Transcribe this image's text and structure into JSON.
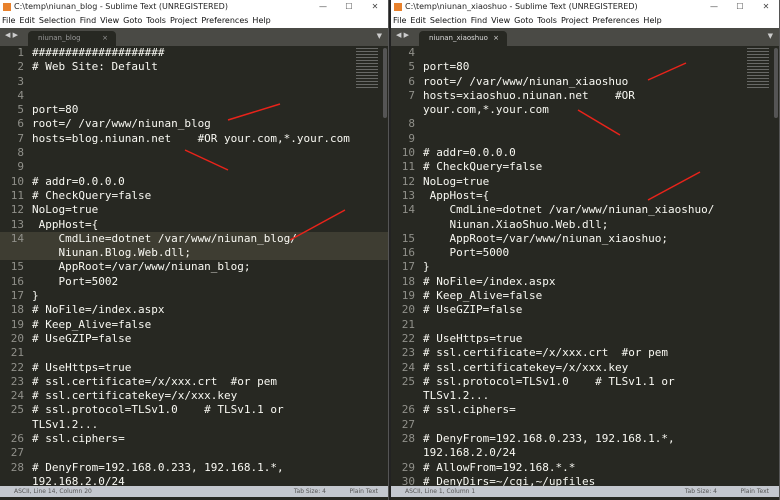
{
  "windows": [
    {
      "title": "C:\\temp\\niunan_blog - Sublime Text (UNREGISTERED)",
      "tab": "niunan_blog",
      "current_line": "14",
      "status": {
        "left": "ASCII, Line 14, Column 20",
        "tab_size": "Tab Size: 4",
        "syntax": "Plain Text"
      },
      "lines": [
        [
          "1",
          "####################"
        ],
        [
          "2",
          "# Web Site: Default"
        ],
        [
          "3",
          ""
        ],
        [
          "4",
          ""
        ],
        [
          "5",
          "port=80"
        ],
        [
          "6",
          "root=/ /var/www/niunan_blog"
        ],
        [
          "7",
          "hosts=blog.niunan.net    #OR your.com,*.your.com"
        ],
        [
          "8",
          ""
        ],
        [
          "9",
          ""
        ],
        [
          "10",
          "# addr=0.0.0.0"
        ],
        [
          "11",
          "# CheckQuery=false"
        ],
        [
          "12",
          "NoLog=true"
        ],
        [
          "13",
          " AppHost={"
        ],
        [
          "14",
          "    CmdLine=dotnet /var/www/niunan_blog/"
        ],
        [
          "",
          "    Niunan.Blog.Web.dll;"
        ],
        [
          "15",
          "    AppRoot=/var/www/niunan_blog;"
        ],
        [
          "16",
          "    Port=5002"
        ],
        [
          "17",
          "}"
        ],
        [
          "18",
          "# NoFile=/index.aspx"
        ],
        [
          "19",
          "# Keep_Alive=false"
        ],
        [
          "20",
          "# UseGZIP=false"
        ],
        [
          "21",
          ""
        ],
        [
          "22",
          "# UseHttps=true"
        ],
        [
          "23",
          "# ssl.certificate=/x/xxx.crt  #or pem"
        ],
        [
          "24",
          "# ssl.certificatekey=/x/xxx.key"
        ],
        [
          "25",
          "# ssl.protocol=TLSv1.0    # TLSv1.1 or"
        ],
        [
          "",
          "TLSv1.2..."
        ],
        [
          "26",
          "# ssl.ciphers="
        ],
        [
          "27",
          ""
        ],
        [
          "28",
          "# DenyFrom=192.168.0.233, 192.168.1.*,"
        ],
        [
          "",
          "192.168.2.0/24"
        ]
      ]
    },
    {
      "title": "C:\\temp\\niunan_xiaoshuo - Sublime Text (UNREGISTERED)",
      "tab": "niunan_xiaoshuo",
      "current_line": "",
      "status": {
        "left": "ASCII, Line 1, Column 1",
        "tab_size": "Tab Size: 4",
        "syntax": "Plain Text"
      },
      "lines": [
        [
          "4",
          ""
        ],
        [
          "5",
          "port=80"
        ],
        [
          "6",
          "root=/ /var/www/niunan_xiaoshuo"
        ],
        [
          "7",
          "hosts=xiaoshuo.niunan.net    #OR"
        ],
        [
          "",
          "your.com,*.your.com"
        ],
        [
          "8",
          ""
        ],
        [
          "9",
          ""
        ],
        [
          "10",
          "# addr=0.0.0.0"
        ],
        [
          "11",
          "# CheckQuery=false"
        ],
        [
          "12",
          "NoLog=true"
        ],
        [
          "13",
          " AppHost={"
        ],
        [
          "14",
          "    CmdLine=dotnet /var/www/niunan_xiaoshuo/"
        ],
        [
          "",
          "    Niunan.XiaoShuo.Web.dll;"
        ],
        [
          "15",
          "    AppRoot=/var/www/niunan_xiaoshuo;"
        ],
        [
          "16",
          "    Port=5000"
        ],
        [
          "17",
          "}"
        ],
        [
          "18",
          "# NoFile=/index.aspx"
        ],
        [
          "19",
          "# Keep_Alive=false"
        ],
        [
          "20",
          "# UseGZIP=false"
        ],
        [
          "21",
          ""
        ],
        [
          "22",
          "# UseHttps=true"
        ],
        [
          "23",
          "# ssl.certificate=/x/xxx.crt  #or pem"
        ],
        [
          "24",
          "# ssl.certificatekey=/x/xxx.key"
        ],
        [
          "25",
          "# ssl.protocol=TLSv1.0    # TLSv1.1 or"
        ],
        [
          "",
          "TLSv1.2..."
        ],
        [
          "26",
          "# ssl.ciphers="
        ],
        [
          "27",
          ""
        ],
        [
          "28",
          "# DenyFrom=192.168.0.233, 192.168.1.*,"
        ],
        [
          "",
          "192.168.2.0/24"
        ],
        [
          "29",
          "# AllowFrom=192.168.*.*"
        ],
        [
          "30",
          "# DenyDirs=~/cgi,~/upfiles"
        ]
      ]
    }
  ],
  "menu": [
    "File",
    "Edit",
    "Selection",
    "Find",
    "View",
    "Goto",
    "Tools",
    "Project",
    "Preferences",
    "Help"
  ],
  "window_controls": {
    "minimize": "—",
    "maximize": "☐",
    "close": "✕"
  },
  "tab_close": "×",
  "annotation_color": "#e8231a"
}
